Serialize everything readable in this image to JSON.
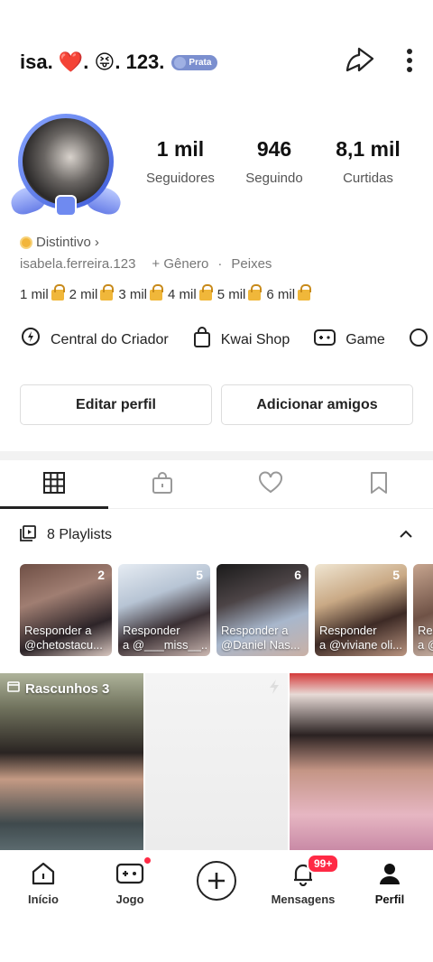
{
  "header": {
    "username": "isa. ❤️. 😝. 123.",
    "badge_label": "Prata",
    "share_icon": "share-arrow-icon",
    "more_icon": "more-vertical-icon"
  },
  "stats": [
    {
      "value": "1 mil",
      "label": "Seguidores"
    },
    {
      "value": "946",
      "label": "Seguindo"
    },
    {
      "value": "8,1 mil",
      "label": "Curtidas"
    }
  ],
  "distintivo": {
    "label": "Distintivo",
    "chevron": "›"
  },
  "info": {
    "handle": "isabela.ferreira.123",
    "gender": "+ Gênero",
    "separator": "·",
    "sign": "Peixes"
  },
  "milestones": [
    "1 mil",
    "2 mil",
    "3 mil",
    "4 mil",
    "5 mil",
    "6 mil"
  ],
  "shortcuts": [
    {
      "label": "Central do Criador",
      "icon": "lightning-pin-icon"
    },
    {
      "label": "Kwai Shop",
      "icon": "shopping-bag-icon"
    },
    {
      "label": "Game",
      "icon": "gamepad-icon"
    }
  ],
  "buttons": {
    "edit_profile": "Editar perfil",
    "add_friends": "Adicionar amigos"
  },
  "tabs": [
    {
      "icon": "grid-icon",
      "active": true
    },
    {
      "icon": "lock-bag-icon",
      "active": false
    },
    {
      "icon": "heart-icon",
      "active": false
    },
    {
      "icon": "bookmark-icon",
      "active": false
    }
  ],
  "playlists_header": {
    "label": "8 Playlists"
  },
  "playlists": [
    {
      "count": "2",
      "line1": "Responder a",
      "line2": "@chetostacu..."
    },
    {
      "count": "5",
      "line1": "Responder",
      "line2": "a @___miss__..."
    },
    {
      "count": "6",
      "line1": "Responder a",
      "line2": "@Daniel Nas..."
    },
    {
      "count": "5",
      "line1": "Responder",
      "line2": "a @viviane oli..."
    },
    {
      "count": "",
      "line1": "Res",
      "line2": "a @"
    }
  ],
  "grid": {
    "draft_label": "Rascunhos 3"
  },
  "bottom_nav": [
    {
      "label": "Início",
      "icon": "home-icon"
    },
    {
      "label": "Jogo",
      "icon": "gamepad-icon"
    },
    {
      "label": "",
      "icon": "plus-circle-icon"
    },
    {
      "label": "Mensagens",
      "icon": "bell-icon",
      "badge": "99+"
    },
    {
      "label": "Perfil",
      "icon": "person-icon"
    }
  ],
  "colors": {
    "accent_red": "#ff2a45",
    "badge_blue": "#7b8fcf",
    "lock_gold": "#f0b73a"
  }
}
